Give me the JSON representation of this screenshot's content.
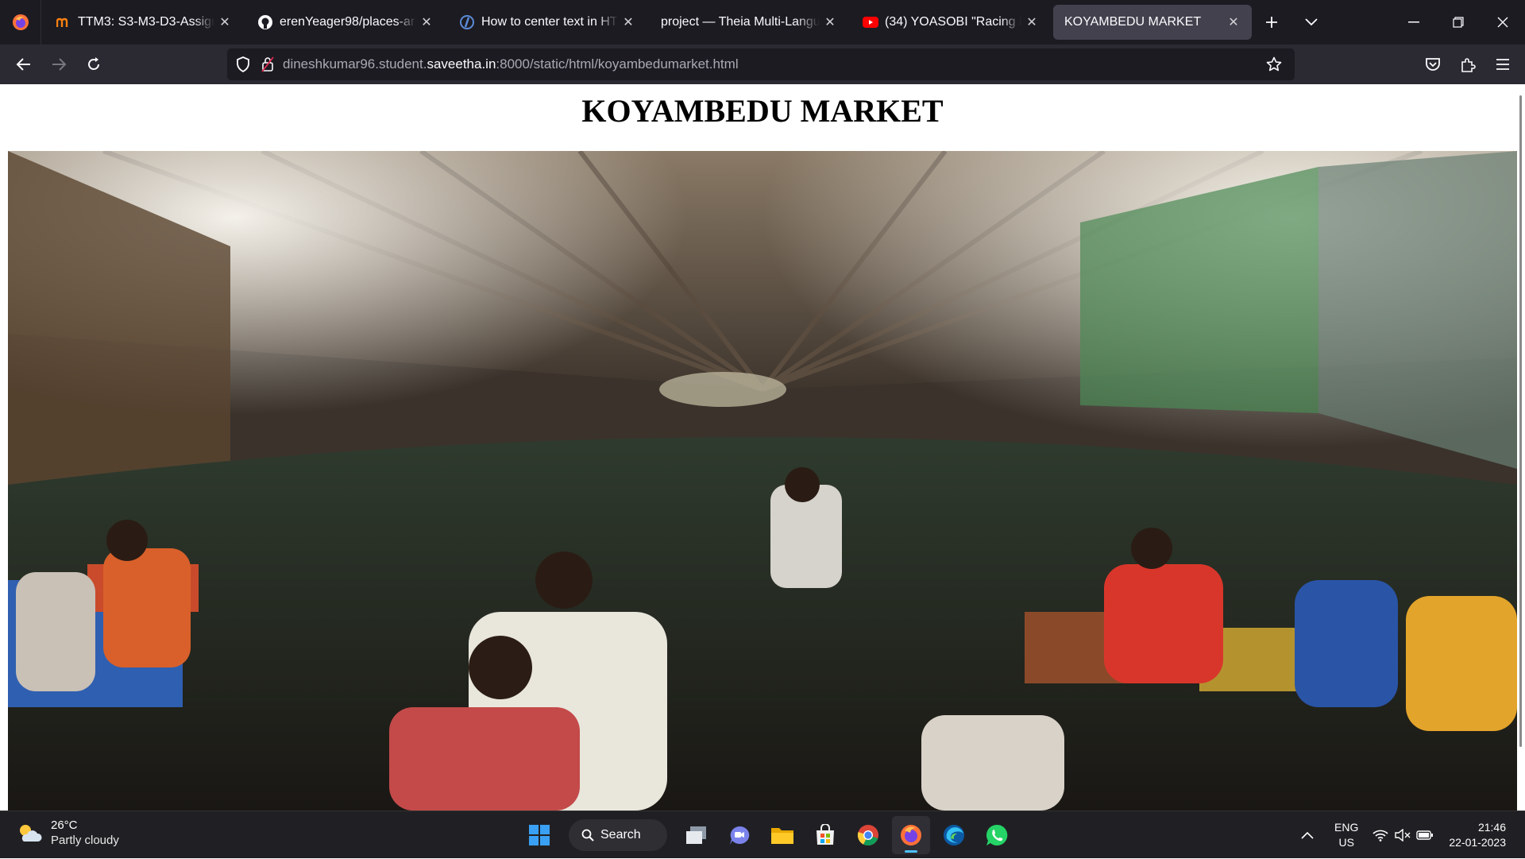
{
  "tabs": [
    {
      "title": "TTM3: S3-M3-D3-Assignment",
      "icon": "moodle-icon"
    },
    {
      "title": "erenYeager98/places-around",
      "icon": "github-icon"
    },
    {
      "title": "How to center text in HTML",
      "icon": "page-icon"
    },
    {
      "title": "project — Theia Multi-Language",
      "icon": "none"
    },
    {
      "title": "(34) YOASOBI \"Racing into the night\"",
      "icon": "youtube-icon"
    },
    {
      "title": "KOYAMBEDU MARKET",
      "icon": "none",
      "active": true
    }
  ],
  "address": {
    "prefix": "dineshkumar96.student.",
    "domain": "saveetha.in",
    "path": ":8000/static/html/koyambedumarket.html"
  },
  "page": {
    "heading": "KOYAMBEDU MARKET",
    "image_description": "Crowded indoor Koyambedu vegetable market under a wooden roof"
  },
  "taskbar": {
    "weather_temp": "26°C",
    "weather_condition": "Partly cloudy",
    "search_label": "Search",
    "lang_line1": "ENG",
    "lang_line2": "US",
    "time": "21:46",
    "date": "22-01-2023"
  },
  "colors": {
    "tabstrip": "#1c1b22",
    "navbar": "#2b2a33",
    "active_tab": "#42414d",
    "taskbar": "#202024",
    "accent": "#4cc2ff"
  }
}
